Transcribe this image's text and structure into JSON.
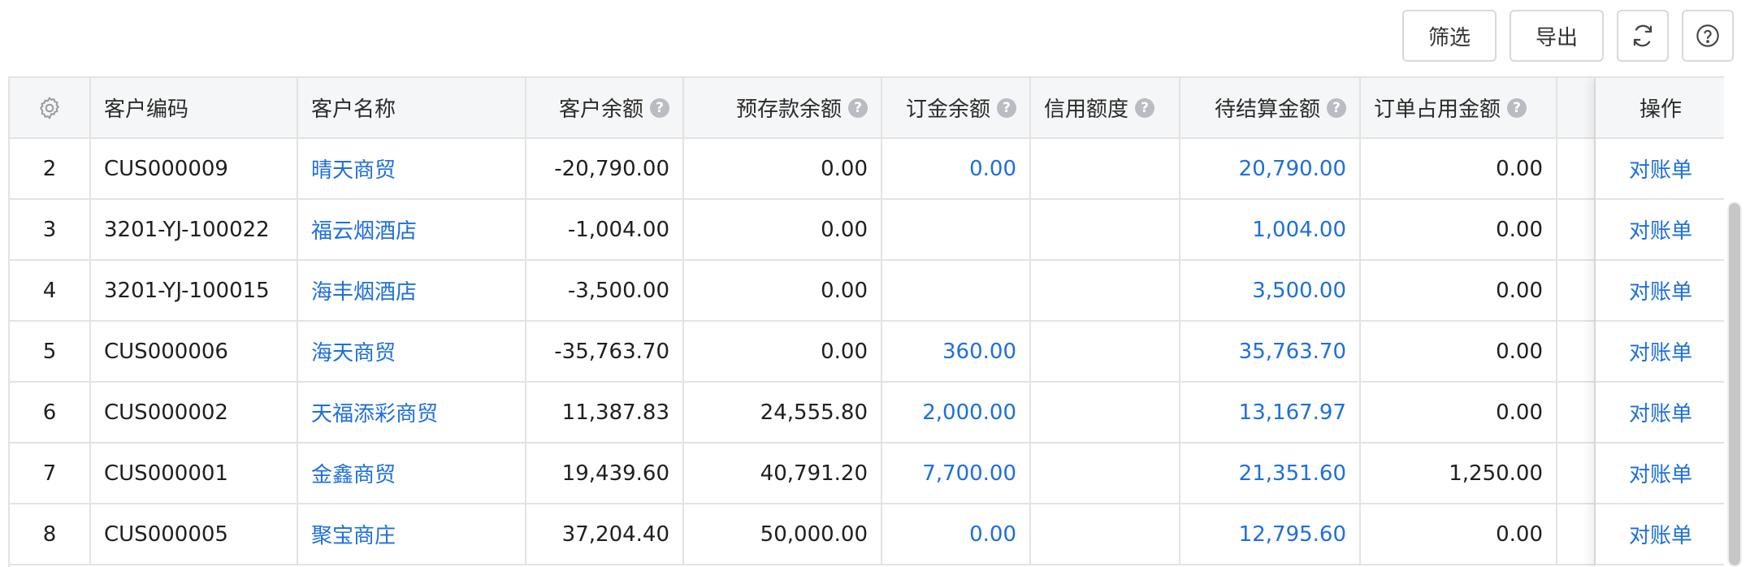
{
  "toolbar": {
    "filter_label": "筛选",
    "export_label": "导出",
    "refresh_icon": "refresh-icon",
    "help_icon": "help-icon"
  },
  "table": {
    "settings_icon": "gear-icon",
    "columns": {
      "code": "客户编码",
      "name": "客户名称",
      "balance": "客户余额",
      "prepay": "预存款余额",
      "deposit": "订金余额",
      "credit": "信用额度",
      "settle": "待结算金额",
      "occupied": "订单占用金额",
      "action": "操作"
    },
    "rows": [
      {
        "idx": "2",
        "code": "CUS000009",
        "name": "晴天商贸",
        "balance": "-20,790.00",
        "prepay": "0.00",
        "deposit": "0.00",
        "credit": "",
        "settle": "20,790.00",
        "occupied": "0.00",
        "action": "对账单"
      },
      {
        "idx": "3",
        "code": "3201-YJ-100022",
        "name": "福云烟酒店",
        "balance": "-1,004.00",
        "prepay": "0.00",
        "deposit": "",
        "credit": "",
        "settle": "1,004.00",
        "occupied": "0.00",
        "action": "对账单"
      },
      {
        "idx": "4",
        "code": "3201-YJ-100015",
        "name": "海丰烟酒店",
        "balance": "-3,500.00",
        "prepay": "0.00",
        "deposit": "",
        "credit": "",
        "settle": "3,500.00",
        "occupied": "0.00",
        "action": "对账单"
      },
      {
        "idx": "5",
        "code": "CUS000006",
        "name": "海天商贸",
        "balance": "-35,763.70",
        "prepay": "0.00",
        "deposit": "360.00",
        "credit": "",
        "settle": "35,763.70",
        "occupied": "0.00",
        "action": "对账单"
      },
      {
        "idx": "6",
        "code": "CUS000002",
        "name": "天福添彩商贸",
        "balance": "11,387.83",
        "prepay": "24,555.80",
        "deposit": "2,000.00",
        "credit": "",
        "settle": "13,167.97",
        "occupied": "0.00",
        "action": "对账单"
      },
      {
        "idx": "7",
        "code": "CUS000001",
        "name": "金鑫商贸",
        "balance": "19,439.60",
        "prepay": "40,791.20",
        "deposit": "7,700.00",
        "credit": "",
        "settle": "21,351.60",
        "occupied": "1,250.00",
        "action": "对账单"
      },
      {
        "idx": "8",
        "code": "CUS000005",
        "name": "聚宝商庄",
        "balance": "37,204.40",
        "prepay": "50,000.00",
        "deposit": "0.00",
        "credit": "",
        "settle": "12,795.60",
        "occupied": "0.00",
        "action": "对账单"
      }
    ]
  },
  "colors": {
    "link": "#1e6fdc",
    "header_bg": "#f5f6f7",
    "border": "#e3e3e3"
  }
}
